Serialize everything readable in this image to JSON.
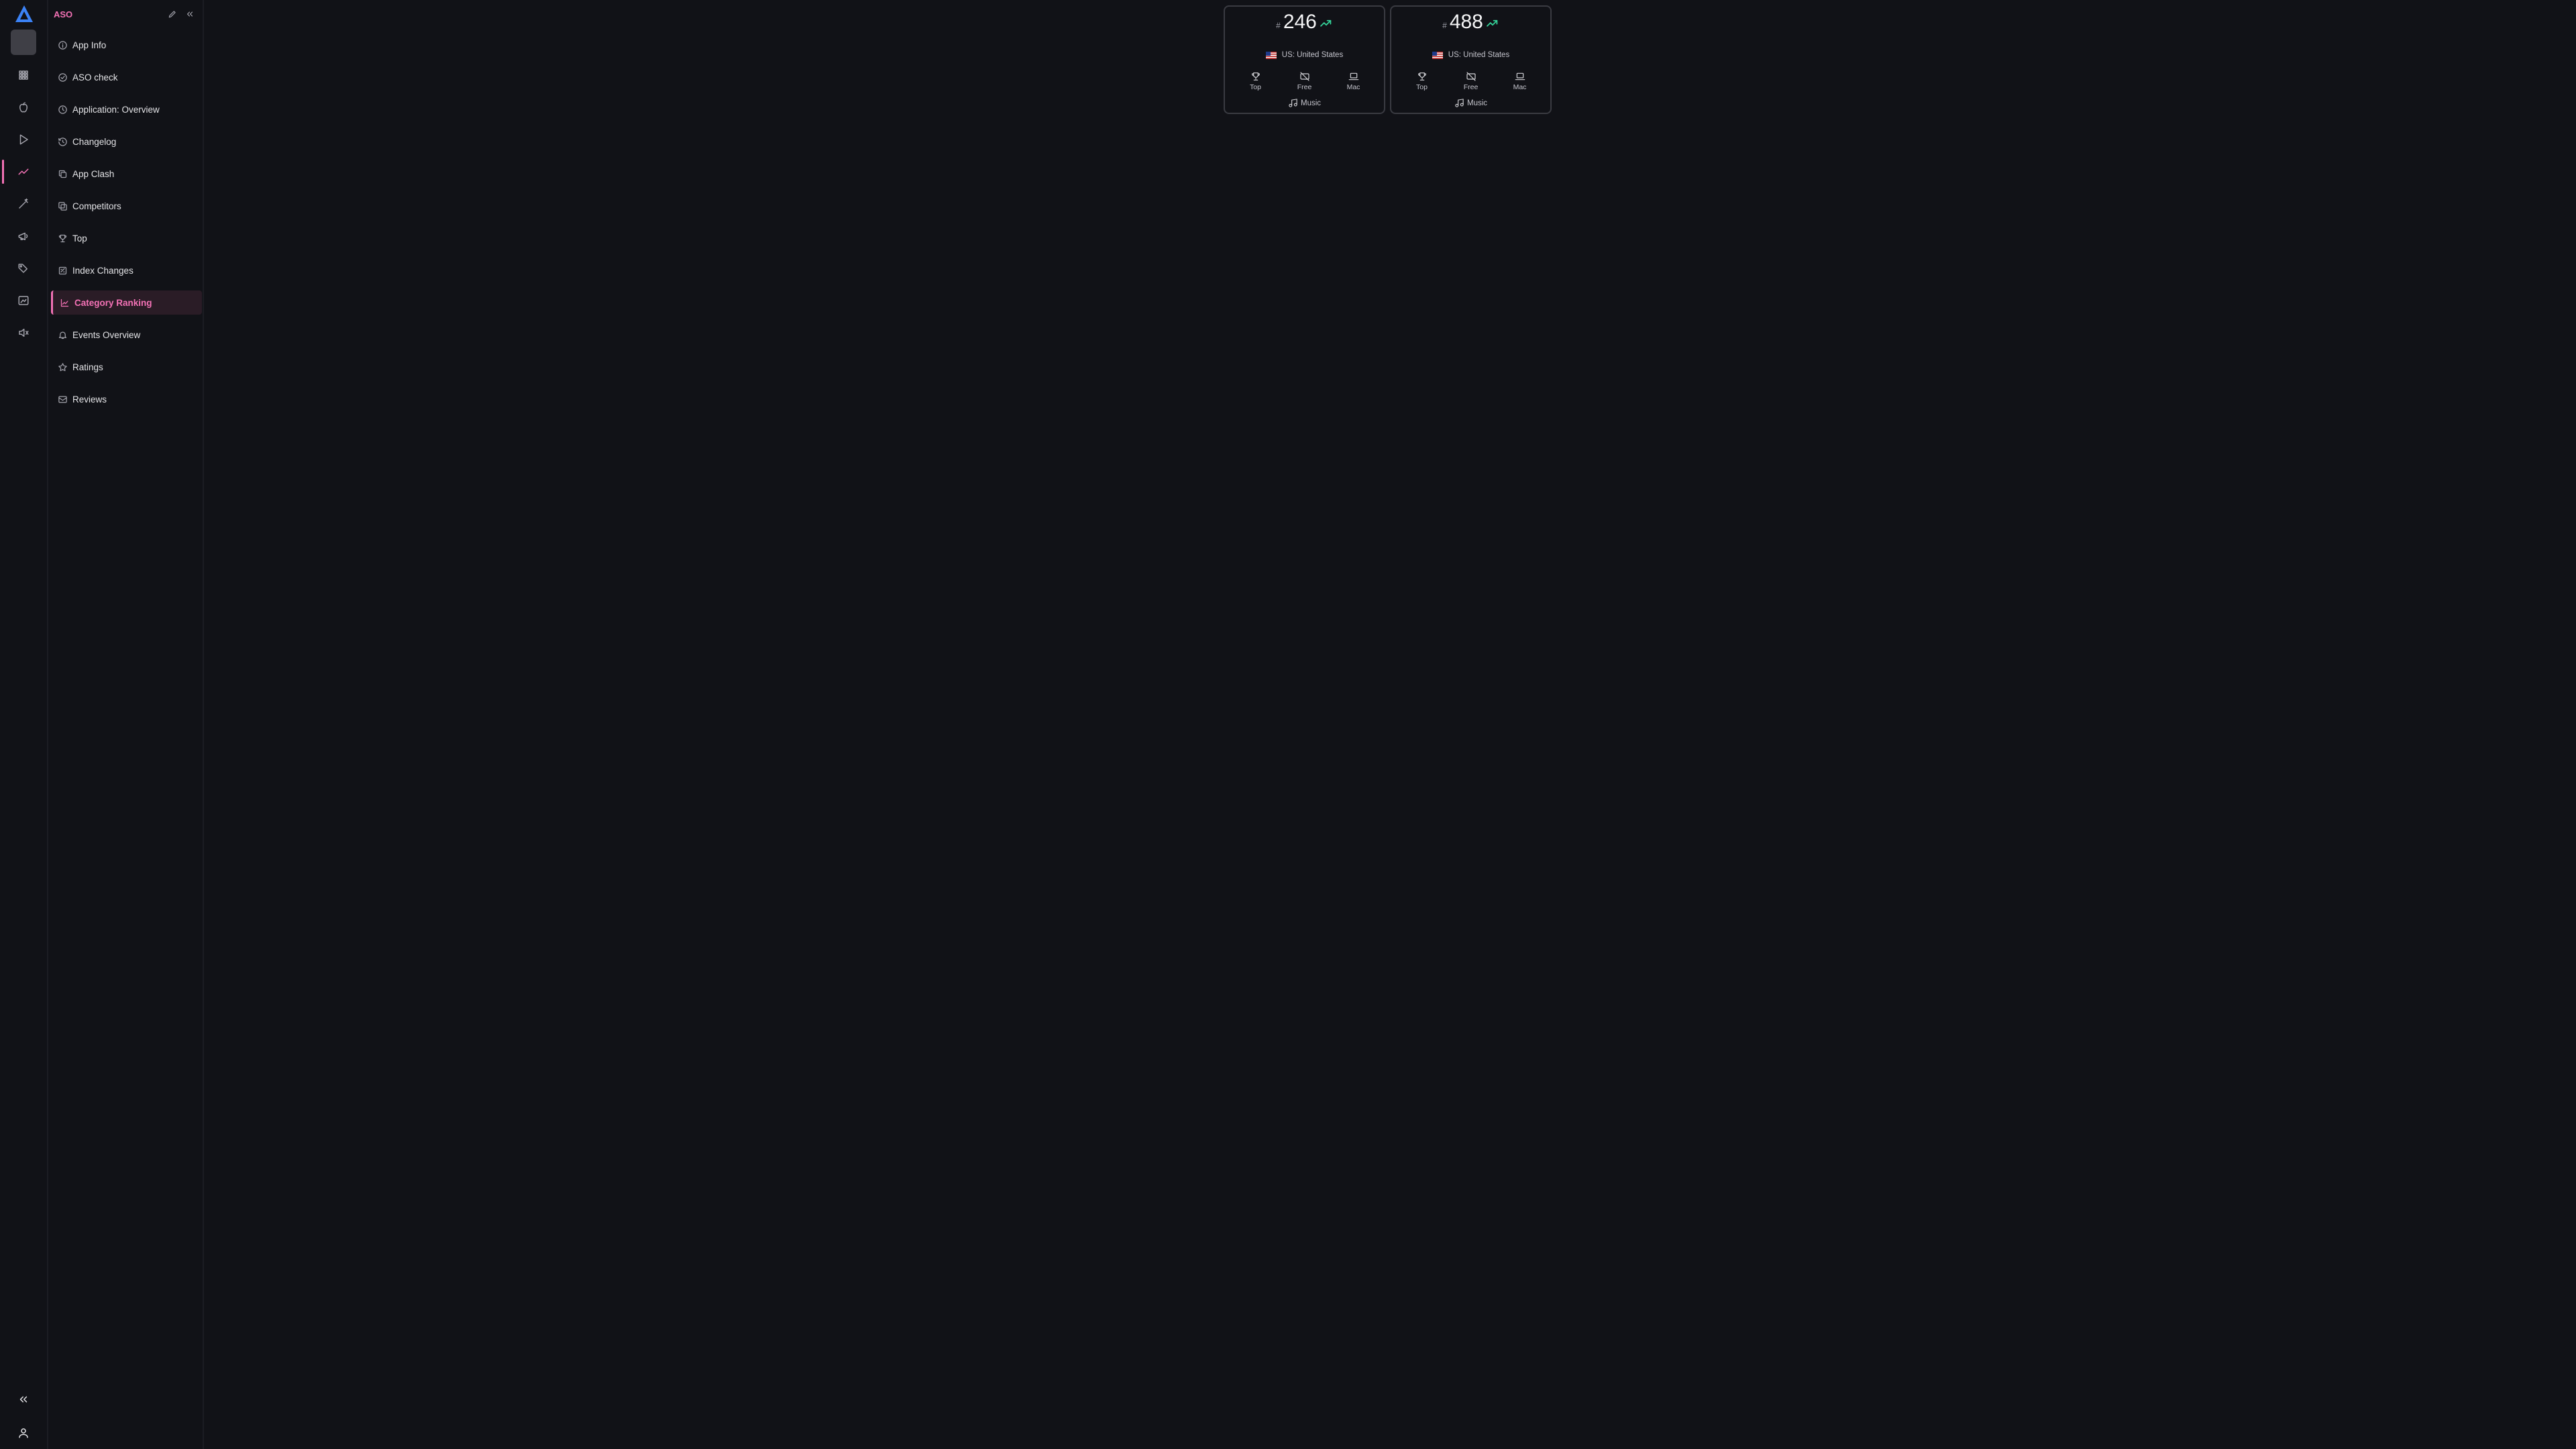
{
  "brand": {
    "accent": "#f472b6",
    "logo_color": "#3b82f6",
    "positive_color": "#34d399"
  },
  "rail": {
    "icons": [
      "apps-grid-icon",
      "apple-icon",
      "play-store-icon",
      "trending-line-icon",
      "wand-icon",
      "megaphone-icon",
      "tags-icon",
      "image-report-icon",
      "speaker-icon"
    ],
    "active": "trending-line-icon",
    "collapse_icon": "chevrons-left-icon",
    "user_icon": "user-icon"
  },
  "sidebar": {
    "title": "ASO",
    "items": [
      {
        "label": "App Info",
        "icon": "info-icon"
      },
      {
        "label": "ASO check",
        "icon": "check-circle-icon"
      },
      {
        "label": "Application: Overview",
        "icon": "clock-icon"
      },
      {
        "label": "Changelog",
        "icon": "history-icon"
      },
      {
        "label": "App Clash",
        "icon": "copy-icon"
      },
      {
        "label": "Competitors",
        "icon": "compare-icon"
      },
      {
        "label": "Top",
        "icon": "trophy-icon"
      },
      {
        "label": "Index Changes",
        "icon": "index-icon"
      },
      {
        "label": "Category Ranking",
        "icon": "chart-icon",
        "active": true
      },
      {
        "label": "Events Overview",
        "icon": "bell-icon"
      },
      {
        "label": "Ratings",
        "icon": "star-icon"
      },
      {
        "label": "Reviews",
        "icon": "message-icon"
      }
    ]
  },
  "cards": [
    {
      "hash": "#",
      "rank": "246",
      "trend": "up",
      "country": "US: United States",
      "filters": [
        {
          "label": "Top",
          "icon": "trophy-icon"
        },
        {
          "label": "Free",
          "icon": "free-icon"
        },
        {
          "label": "Mac",
          "icon": "laptop-icon"
        }
      ],
      "genre": "Music"
    },
    {
      "hash": "#",
      "rank": "488",
      "trend": "up",
      "country": "US: United States",
      "filters": [
        {
          "label": "Top",
          "icon": "trophy-icon"
        },
        {
          "label": "Free",
          "icon": "free-icon"
        },
        {
          "label": "Mac",
          "icon": "laptop-icon"
        }
      ],
      "genre": "Music"
    }
  ]
}
